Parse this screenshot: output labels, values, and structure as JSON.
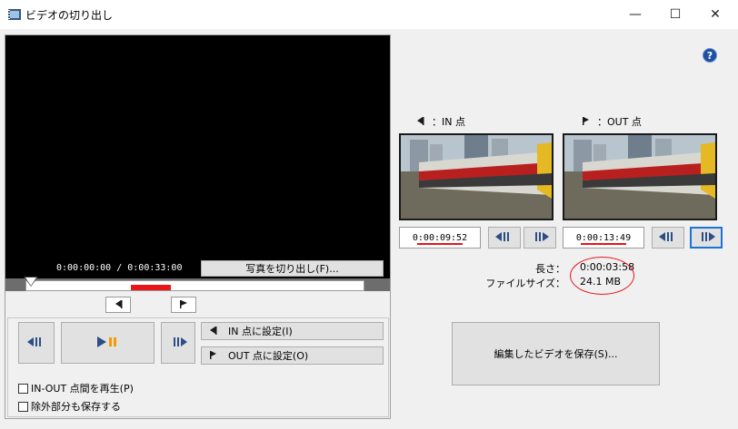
{
  "window": {
    "title": "ビデオの切り出し",
    "min_label": "—",
    "max_label": "☐",
    "close_label": "✕"
  },
  "help": {
    "label": "?"
  },
  "player": {
    "timecode": "0:00:00:00 / 0:00:33:00",
    "extract_photo_label": "写真を切り出し(F)...",
    "trim_selection_fraction": [
      0.309,
      0.427
    ]
  },
  "controls": {
    "set_in_label": "IN 点に設定(I)",
    "set_out_label": "OUT 点に設定(O)",
    "play_in_out_label": "IN-OUT 点間を再生(P)",
    "save_excluded_label": "除外部分も保存する",
    "play_in_out_checked": false,
    "save_excluded_checked": false
  },
  "in_point": {
    "legend": "：IN 点",
    "timecode": "0:00:09:52"
  },
  "out_point": {
    "legend": "：OUT 点",
    "timecode": "0:00:13:49"
  },
  "info": {
    "length_label": "長さ：",
    "length_value": "0:00:03:58",
    "filesize_label": "ファイルサイズ：",
    "filesize_value": "24.1 MB"
  },
  "save_button_label": "編集したビデオを保存(S)...",
  "colors": {
    "accent_red": "#e8151b",
    "active_blue": "#1a73d6",
    "play_icon_orange": "#f59a00",
    "nav_icon_blue": "#2d4d87"
  }
}
